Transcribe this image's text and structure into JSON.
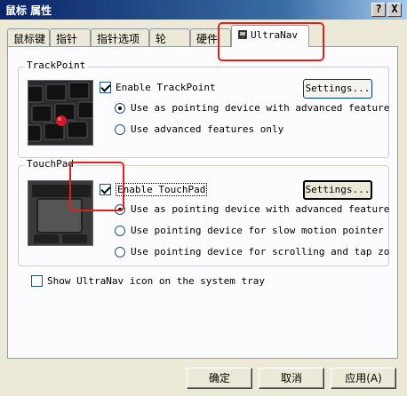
{
  "window": {
    "title": "鼠标 属性",
    "help_glyph": "?",
    "close_glyph": "X"
  },
  "tabs": [
    {
      "label": "鼠标键"
    },
    {
      "label": "指针"
    },
    {
      "label": "指针选项"
    },
    {
      "label": "轮"
    },
    {
      "label": "硬件"
    },
    {
      "label": "UltraNav",
      "active": true
    }
  ],
  "trackpoint": {
    "group_label": "TrackPoint",
    "enable_label": "Enable TrackPoint",
    "enable_checked": true,
    "settings_label": "Settings...",
    "option1": "Use as pointing device with advanced feature",
    "option2": "Use advanced features only",
    "selected": 1
  },
  "touchpad": {
    "group_label": "TouchPad",
    "enable_label": "Enable TouchPad",
    "enable_checked": true,
    "settings_label": "Settings...",
    "option1": "Use as pointing device with advanced feature",
    "option2": "Use pointing device for slow motion pointer",
    "option3": "Use pointing device for scrolling and tap zo",
    "selected": 1
  },
  "tray": {
    "label": "Show UltraNav icon on the system tray",
    "checked": false
  },
  "footer": {
    "ok_label": "确定",
    "cancel_label": "取消",
    "apply_label": "应用(A)"
  },
  "colors": {
    "title_bar": "#0a246a",
    "highlight": "#e02020",
    "face": "#ece9d8"
  }
}
